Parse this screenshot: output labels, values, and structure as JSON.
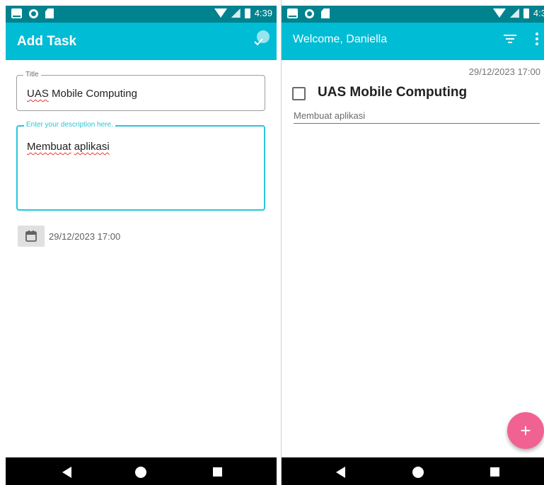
{
  "add_task_screen": {
    "status_time": "4:39",
    "appbar_title": "Add Task",
    "title_field": {
      "label": "Title",
      "value_word1": "UAS",
      "value_rest": " Mobile Computing"
    },
    "description_field": {
      "label": "Enter your description here.",
      "value_word1": "Membuat",
      "value_word2": "aplikasi"
    },
    "date_text": "29/12/2023 17:00",
    "icons": [
      "photo-icon",
      "circle-icon",
      "sd-card-icon",
      "wifi-icon",
      "signal-icon",
      "battery-icon",
      "save-check-icon",
      "calendar-icon",
      "back-icon",
      "home-icon",
      "recents-icon"
    ]
  },
  "task_list_screen": {
    "status_time": "4:3",
    "appbar_title": "Welcome, Daniella",
    "tasks": [
      {
        "date": "29/12/2023 17:00",
        "title": "UAS Mobile Computing",
        "description": "Membuat aplikasi",
        "checked": false
      }
    ],
    "fab_label": "+",
    "icons": [
      "filter-icon",
      "overflow-menu-icon",
      "add-icon"
    ]
  },
  "colors": {
    "status_bar": "#00838f",
    "app_bar": "#00bcd4",
    "focus_outline": "#26c6da",
    "fab": "#f06292"
  }
}
